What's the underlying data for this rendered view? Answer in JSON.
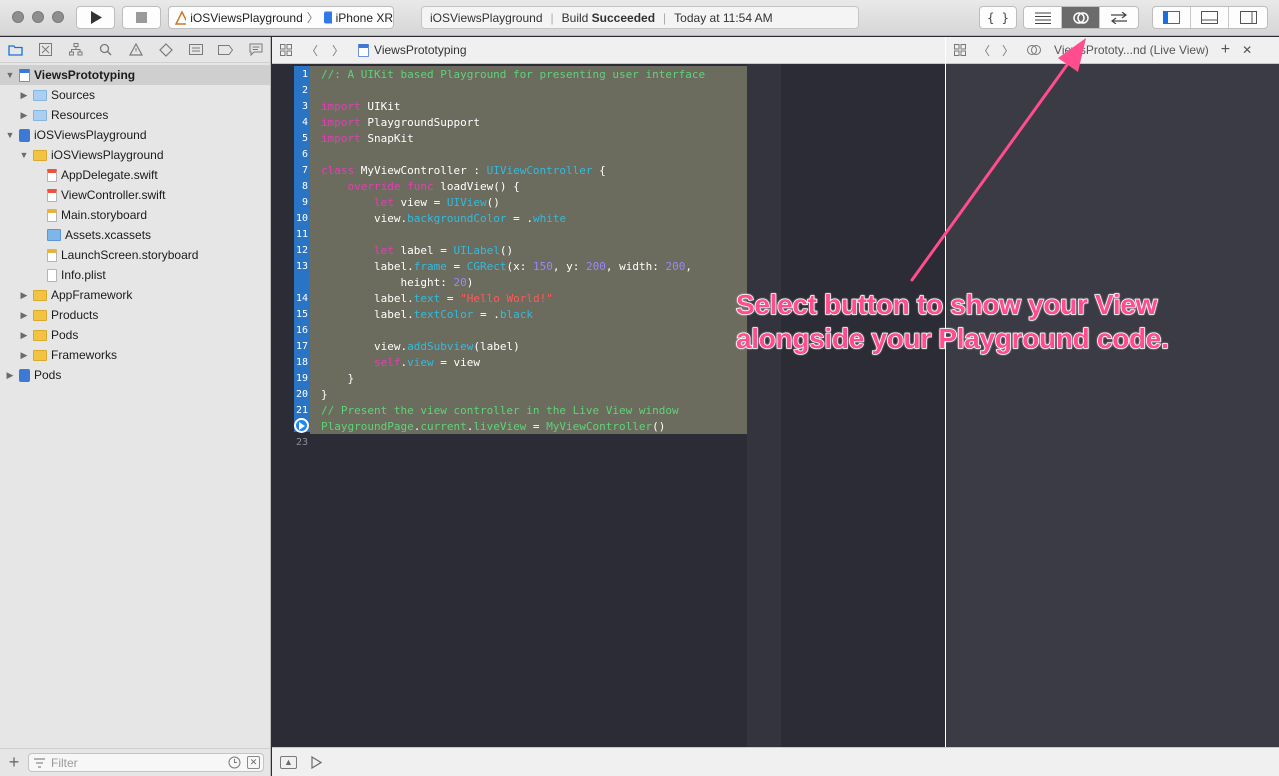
{
  "toolbar": {
    "scheme_project": "iOSViewsPlayground",
    "scheme_device": "iPhone XR",
    "status_project": "iOSViewsPlayground",
    "status_build_prefix": "Build",
    "status_build_result": "Succeeded",
    "status_time": "Today at 11:54 AM"
  },
  "navigator": {
    "items": [
      {
        "label": "ViewsPrototyping",
        "icon": "playground-icon"
      },
      {
        "label": "Sources",
        "icon": "folder-icon"
      },
      {
        "label": "Resources",
        "icon": "folder-icon"
      },
      {
        "label": "iOSViewsPlayground",
        "icon": "project-icon"
      },
      {
        "label": "iOSViewsPlayground",
        "icon": "folder-icon"
      },
      {
        "label": "AppDelegate.swift",
        "icon": "swift-file-icon"
      },
      {
        "label": "ViewController.swift",
        "icon": "swift-file-icon"
      },
      {
        "label": "Main.storyboard",
        "icon": "storyboard-icon"
      },
      {
        "label": "Assets.xcassets",
        "icon": "asset-catalog-icon"
      },
      {
        "label": "LaunchScreen.storyboard",
        "icon": "storyboard-icon"
      },
      {
        "label": "Info.plist",
        "icon": "plist-icon"
      },
      {
        "label": "AppFramework",
        "icon": "folder-icon"
      },
      {
        "label": "Products",
        "icon": "folder-icon"
      },
      {
        "label": "Pods",
        "icon": "folder-icon"
      },
      {
        "label": "Frameworks",
        "icon": "folder-icon"
      },
      {
        "label": "Pods",
        "icon": "project-icon"
      }
    ],
    "filter_placeholder": "Filter"
  },
  "editor": {
    "breadcrumb": "ViewsPrototyping",
    "line_numbers": [
      "1",
      "2",
      "3",
      "4",
      "5",
      "6",
      "7",
      "8",
      "9",
      "10",
      "11",
      "12",
      "13",
      "",
      "14",
      "15",
      "16",
      "17",
      "18",
      "19",
      "20",
      "21",
      "22",
      "23"
    ],
    "code": {
      "l1": "//: A UIKit based Playground for presenting user interface",
      "l3_kw": "import",
      "l3_rest": " UIKit",
      "l4_kw": "import",
      "l4_rest": " PlaygroundSupport",
      "l5_kw": "import",
      "l5_rest": " SnapKit",
      "l7_kw": "class",
      "l7_name": " MyViewController : ",
      "l7_type": "UIViewController",
      "l7_end": " {",
      "l8_kw1": "override",
      "l8_kw2": "func",
      "l8_rest": " loadView() {",
      "l9_kw": "let",
      "l9_mid": " view = ",
      "l9_type": "UIView",
      "l9_end": "()",
      "l10_a": "view.",
      "l10_prop": "backgroundColor",
      "l10_mid": " = .",
      "l10_val": "white",
      "l12_kw": "let",
      "l12_mid": " label = ",
      "l12_type": "UILabel",
      "l12_end": "()",
      "l13_a": "label.",
      "l13_prop": "frame",
      "l13_mid": " = ",
      "l13_type": "CGRect",
      "l13_x": "(x: ",
      "l13_xv": "150",
      "l13_y": ", y: ",
      "l13_yv": "200",
      "l13_w": ", width: ",
      "l13_wv": "200",
      "l13_end": ",",
      "l13b_a": "height: ",
      "l13b_v": "20",
      "l13b_end": ")",
      "l14_a": "label.",
      "l14_prop": "text",
      "l14_mid": " = ",
      "l14_str": "\"Hello World!\"",
      "l15_a": "label.",
      "l15_prop": "textColor",
      "l15_mid": " = .",
      "l15_val": "black",
      "l17_a": "view.",
      "l17_prop": "addSubview",
      "l17_end": "(label)",
      "l18_kw": "self",
      "l18_dot": ".",
      "l18_prop": "view",
      "l18_end": " = view",
      "l19": "}",
      "l20": "}",
      "l21": "// Present the view controller in the Live View window",
      "l22_a": "PlaygroundPage",
      "l22_dot1": ".",
      "l22_b": "current",
      "l22_dot2": ".",
      "l22_c": "liveView",
      "l22_mid": " = ",
      "l22_d": "MyViewController",
      "l22_end": "()"
    }
  },
  "assistant": {
    "breadcrumb": "ViewsPrototy...nd (Live View)"
  },
  "annotation": {
    "line1": "Select button to show your View",
    "line2": "alongside your Playground code.",
    "color": "#ff4d8d"
  }
}
